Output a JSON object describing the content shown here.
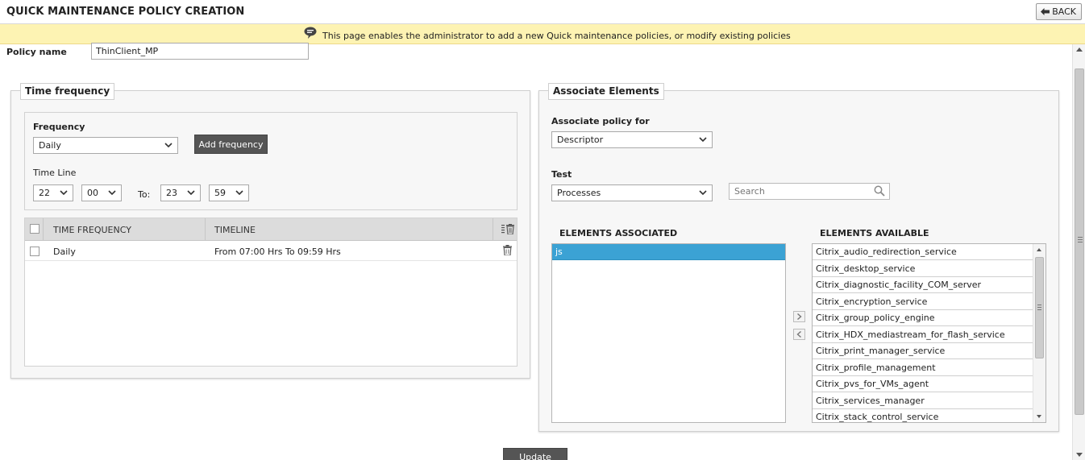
{
  "header": {
    "title": "QUICK MAINTENANCE POLICY CREATION",
    "back_label": "BACK"
  },
  "info": {
    "message": "This page enables the administrator to add a new Quick maintenance policies, or modify existing policies"
  },
  "policy": {
    "label": "Policy name",
    "value": "ThinClient_MP"
  },
  "time_frequency": {
    "legend": "Time frequency",
    "frequency_label": "Frequency",
    "frequency_value": "Daily",
    "add_frequency_label": "Add frequency",
    "timeline_label": "Time Line",
    "from_hour": "22",
    "from_minute": "00",
    "to_label": "To:",
    "to_hour": "23",
    "to_minute": "59",
    "table": {
      "columns": [
        "TIME FREQUENCY",
        "TIMELINE"
      ],
      "rows": [
        {
          "frequency": "Daily",
          "timeline": "From 07:00 Hrs To 09:59 Hrs"
        }
      ]
    }
  },
  "associate": {
    "legend": "Associate Elements",
    "policy_for_label": "Associate policy for",
    "policy_for_value": "Descriptor",
    "test_label": "Test",
    "test_value": "Processes",
    "search_placeholder": "Search",
    "associated_header": "ELEMENTS ASSOCIATED",
    "available_header": "ELEMENTS AVAILABLE",
    "associated": [
      "js"
    ],
    "available": [
      "Citrix_audio_redirection_service",
      "Citrix_desktop_service",
      "Citrix_diagnostic_facility_COM_server",
      "Citrix_encryption_service",
      "Citrix_group_policy_engine",
      "Citrix_HDX_mediastream_for_flash_service",
      "Citrix_print_manager_service",
      "Citrix_profile_management",
      "Citrix_pvs_for_VMs_agent",
      "Citrix_services_manager",
      "Citrix_stack_control_service"
    ]
  },
  "footer": {
    "update_label": "Update"
  },
  "colors": {
    "info_bar": "#fdf3b3",
    "dark_button": "#555555",
    "selected_item": "#3ba2d4",
    "table_header": "#dcdcdc"
  }
}
